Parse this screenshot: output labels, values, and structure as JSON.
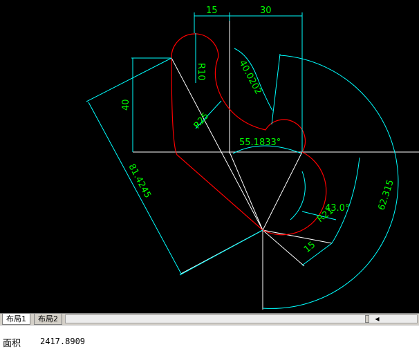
{
  "drawing": {
    "dimensions": {
      "top_left": "15",
      "top_right": "30",
      "radius_top": "R10",
      "vertical_40": "40",
      "arc_length": "40.0202",
      "radius_25": "R25",
      "angle_55": "55.1833°",
      "aligned_81": "81.4245",
      "angle_43": "43.0°",
      "arc_62": "62.315",
      "radius_21": "R21",
      "aligned_15": "15"
    }
  },
  "tabs": {
    "layout1": "布局1",
    "layout2": "布局2"
  },
  "command": {
    "label": "面积",
    "value": "2417.8909"
  },
  "colors": {
    "canvas": "#000000",
    "geometry": "#ff0000",
    "dimension_lines": "#00ffff",
    "dimension_text": "#00ff00",
    "construction": "#ffffff"
  }
}
